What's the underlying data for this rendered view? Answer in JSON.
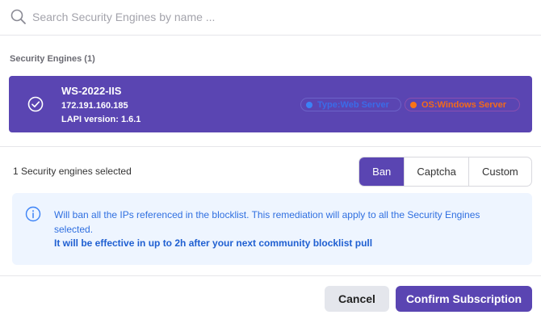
{
  "search": {
    "placeholder": "Search Security Engines by name ...",
    "value": ""
  },
  "engines_section": {
    "title": "Security Engines (1)",
    "items": [
      {
        "name": "WS-2022-IIS",
        "ip": "172.191.160.185",
        "lapi": "LAPI version: 1.6.1",
        "selected": true,
        "tags": [
          {
            "label": "Type:Web Server",
            "dot_color": "#3b82f6"
          },
          {
            "label": "OS:Windows Server",
            "dot_color": "#f97316"
          }
        ]
      }
    ]
  },
  "selection": {
    "count_text": "1 Security engines selected"
  },
  "remediation": {
    "options": [
      "Ban",
      "Captcha",
      "Custom"
    ],
    "selected": "Ban"
  },
  "info": {
    "icon": "info-icon",
    "text": "Will ban all the IPs referenced in the blocklist. This remediation will apply to all the Security Engines selected.",
    "strong_text": "It will be effective in up to 2h after your next community blocklist pull"
  },
  "footer": {
    "cancel_label": "Cancel",
    "confirm_label": "Confirm Subscription"
  },
  "colors": {
    "accent": "#5a45b2",
    "info_bg": "#eef5ff",
    "info_text": "#2f6fe0"
  }
}
